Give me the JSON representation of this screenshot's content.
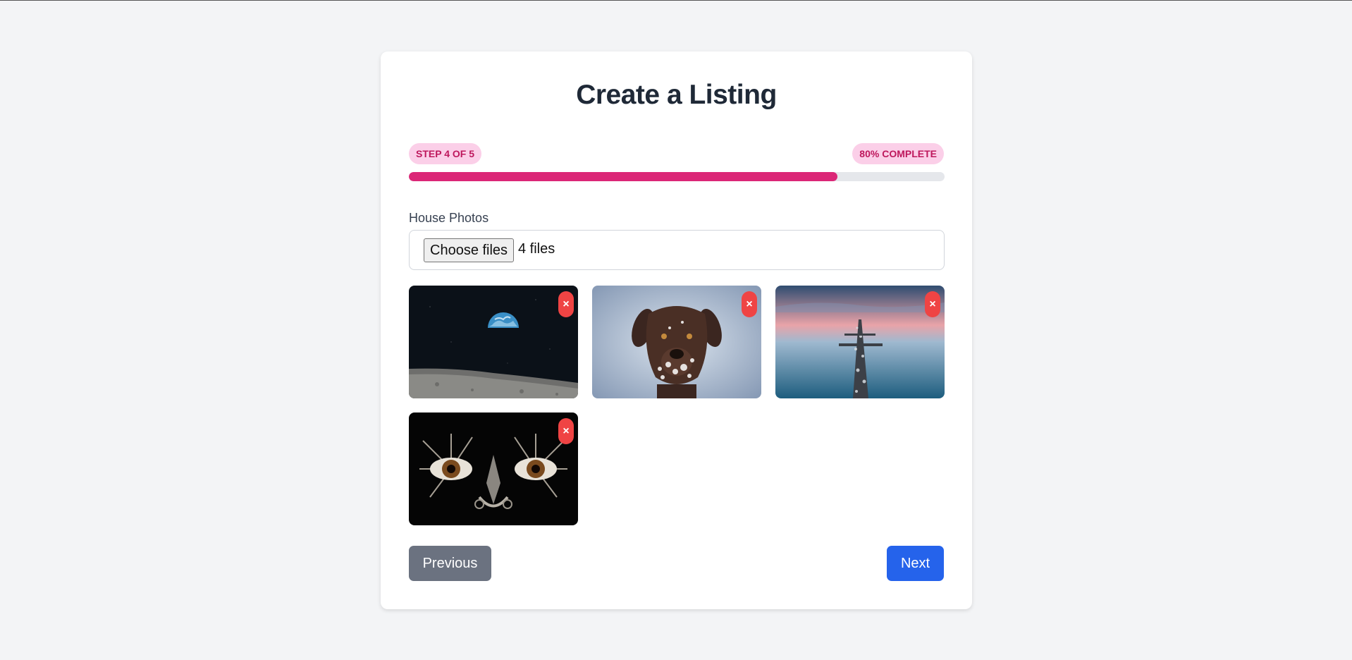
{
  "page": {
    "title": "Create a Listing"
  },
  "progress": {
    "step_label": "STEP 4 OF 5",
    "complete_label": "80% COMPLETE",
    "percent": 80,
    "fill_color": "#db2777",
    "track_color": "#e5e7eb"
  },
  "upload": {
    "label": "House Photos",
    "button_label": "Choose files",
    "file_count": "4 files"
  },
  "photos": [
    {
      "subject": "earth-rising-over-moon",
      "remove_label": "×"
    },
    {
      "subject": "chocolate-labrador-in-snow",
      "remove_label": "×"
    },
    {
      "subject": "pier-into-calm-sea",
      "remove_label": "×"
    },
    {
      "subject": "metallic-mechanical-eyes-mask",
      "remove_label": "×"
    }
  ],
  "navigation": {
    "previous_label": "Previous",
    "next_label": "Next"
  },
  "colors": {
    "accent": "#db2777",
    "primary_button": "#2563eb",
    "secondary_button": "#6b7280",
    "remove_button": "#ef4444",
    "background": "#f3f4f6"
  }
}
